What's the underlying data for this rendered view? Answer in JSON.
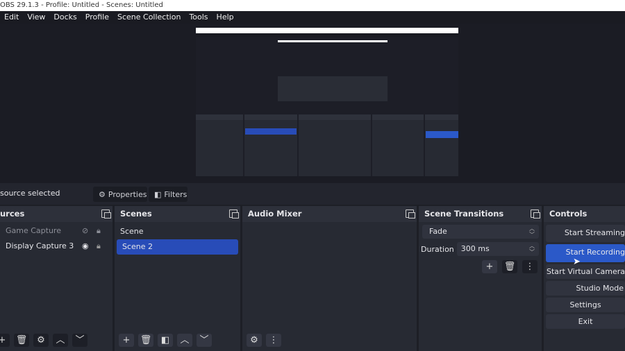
{
  "window": {
    "title": "OBS 29.1.3 - Profile: Untitled - Scenes: Untitled"
  },
  "menu": [
    "Edit",
    "View",
    "Docks",
    "Profile",
    "Scene Collection",
    "Tools",
    "Help"
  ],
  "status": {
    "no_source": "source selected",
    "properties": "Properties",
    "filters": "Filters"
  },
  "sources": {
    "title": "urces",
    "items": [
      {
        "label": "Game Capture",
        "visible": false,
        "locked": true
      },
      {
        "label": "Display Capture 3",
        "visible": true,
        "locked": true
      }
    ]
  },
  "scenes": {
    "title": "Scenes",
    "items": [
      "Scene",
      "Scene 2"
    ],
    "selected": "Scene 2"
  },
  "audio": {
    "title": "Audio Mixer"
  },
  "transitions": {
    "title": "Scene Transitions",
    "transition": "Fade",
    "duration_label": "Duration",
    "duration": "300 ms"
  },
  "controls": {
    "title": "Controls",
    "buttons": [
      "Start Streaming",
      "Start Recording",
      "Start Virtual Camera",
      "Studio Mode",
      "Settings",
      "Exit"
    ],
    "active": "Start Recording"
  },
  "colors": {
    "accent": "#284cb8",
    "active_button": "#2b59c8"
  }
}
